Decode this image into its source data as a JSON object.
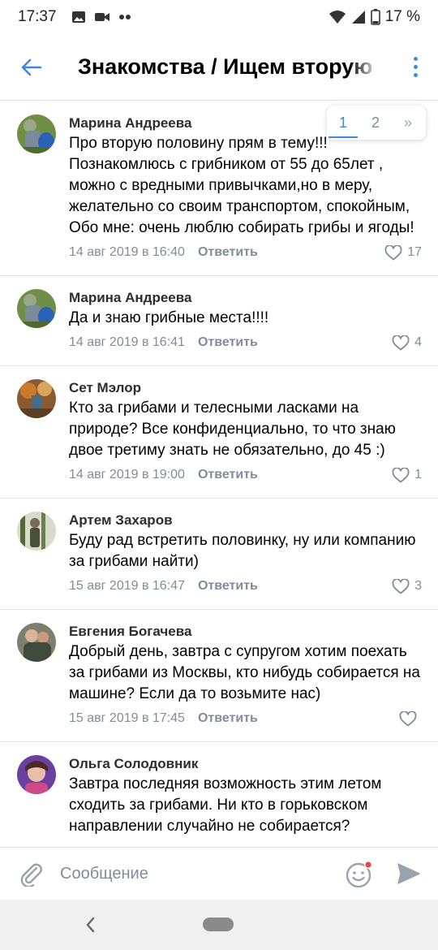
{
  "status_bar": {
    "time": "17:37",
    "battery": "17 %"
  },
  "header": {
    "title": "Знакомства / Ищем вторую половинку"
  },
  "pagination": {
    "pages": [
      "1",
      "2"
    ],
    "active_page": "1",
    "next": "»"
  },
  "comments": [
    {
      "author": "Марина Андреева",
      "text": "Про вторую половину прям в тему!!! Познакомлюсь с грибником от 55 до 65лет , можно с вредными привычками,но в меру, желательно со своим транспортом, спокойным, Обо мне: очень люблю собирать грибы и ягоды!",
      "date": "14 авг 2019 в 16:40",
      "reply": "Ответить",
      "likes": "17"
    },
    {
      "author": "Марина Андреева",
      "text": "Да и знаю грибные места!!!!",
      "date": "14 авг 2019 в 16:41",
      "reply": "Ответить",
      "likes": "4"
    },
    {
      "author": "Сет Мэлор",
      "text": "Кто за грибами и телесными ласками на природе? Все конфиденциально, то что знаю двое третиму знать не обязательно, до 45 :)",
      "date": "14 авг 2019 в 19:00",
      "reply": "Ответить",
      "likes": "1"
    },
    {
      "author": "Артем Захаров",
      "text": "Буду рад встретить половинку, ну или компанию за грибами найти)",
      "date": "15 авг 2019 в 16:47",
      "reply": "Ответить",
      "likes": "3"
    },
    {
      "author": "Евгения Богачева",
      "text": "Добрый день, завтра с супругом хотим поехать за грибами из Москвы, кто нибудь собирается на машине? Если да то возьмите нас)",
      "date": "15 авг 2019 в 17:45",
      "reply": "Ответить",
      "likes": ""
    },
    {
      "author": "Ольга Солодовник",
      "text": "Завтра последняя возможность этим летом сходить за грибами. Ни кто в горьковском направлении случайно не собирается?",
      "date": "",
      "reply": "",
      "likes": ""
    }
  ],
  "composer": {
    "placeholder": "Сообщение"
  },
  "colors": {
    "accent": "#3f8ae0",
    "secondary_text": "#818c99",
    "divider": "#e3e4e6"
  }
}
